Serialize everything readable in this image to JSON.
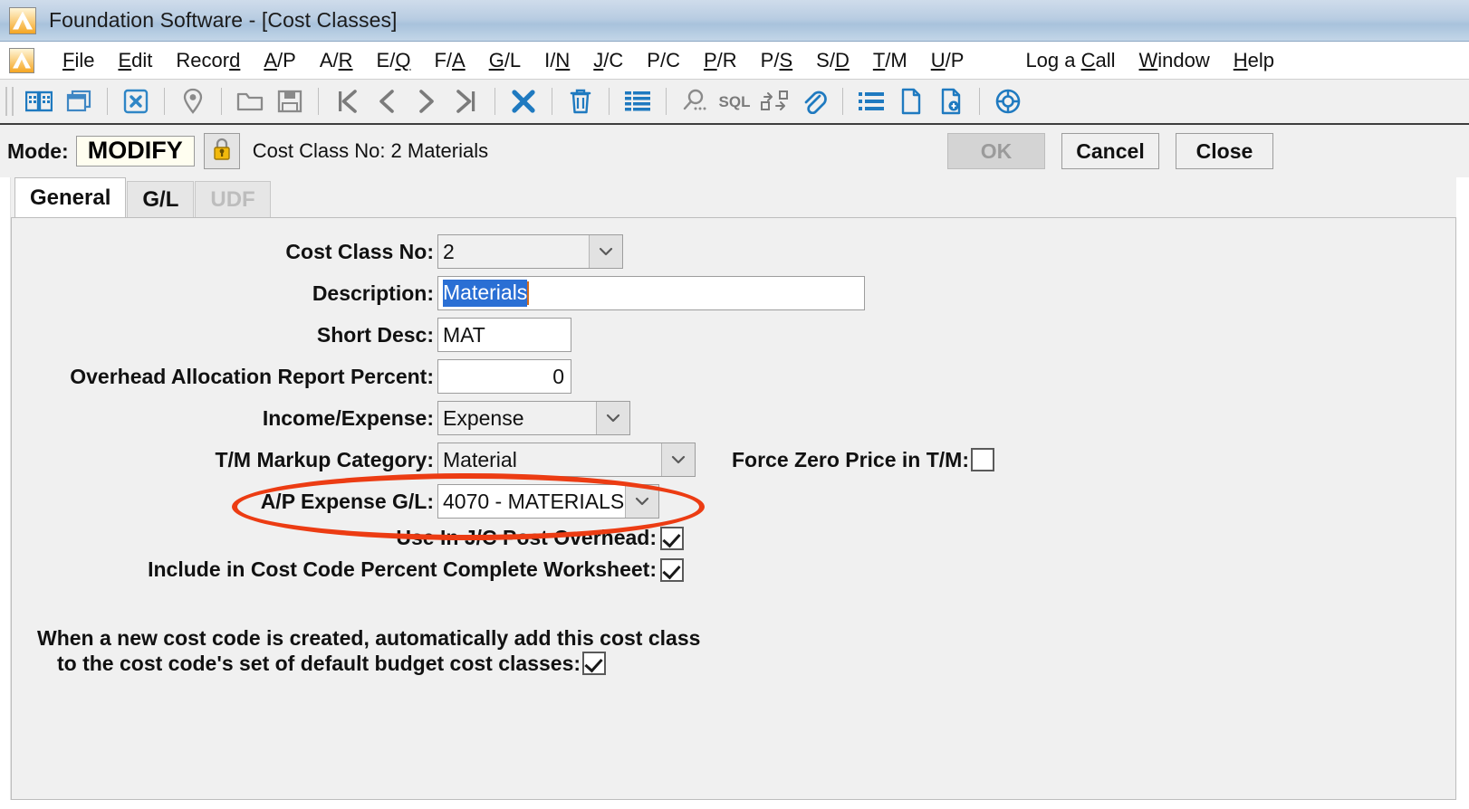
{
  "window": {
    "title": "Foundation Software - [Cost Classes]",
    "logo_icon": "mountain-logo-icon"
  },
  "menubar": {
    "items": [
      {
        "label": "File",
        "accel": "F"
      },
      {
        "label": "Edit",
        "accel": "E"
      },
      {
        "label": "Record",
        "accel": "d"
      },
      {
        "label": "A/P",
        "accel": "A"
      },
      {
        "label": "A/R",
        "accel": "R"
      },
      {
        "label": "E/Q",
        "accel": "Q"
      },
      {
        "label": "F/A",
        "accel": "A"
      },
      {
        "label": "G/L",
        "accel": "G"
      },
      {
        "label": "I/N",
        "accel": "N"
      },
      {
        "label": "J/C",
        "accel": "J"
      },
      {
        "label": "P/C",
        "accel": ""
      },
      {
        "label": "P/R",
        "accel": "P"
      },
      {
        "label": "P/S",
        "accel": "S"
      },
      {
        "label": "S/D",
        "accel": "D"
      },
      {
        "label": "T/M",
        "accel": "T"
      },
      {
        "label": "U/P",
        "accel": "U"
      },
      {
        "label": "Log a Call",
        "accel": "C"
      },
      {
        "label": "Window",
        "accel": "W"
      },
      {
        "label": "Help",
        "accel": "H"
      }
    ]
  },
  "toolbar": {
    "buttons": [
      {
        "name": "open-book-icon",
        "group": 1
      },
      {
        "name": "windows-cascade-icon",
        "group": 1
      },
      {
        "name": "close-window-x-icon",
        "group": 2
      },
      {
        "name": "location-pin-icon",
        "group": 3
      },
      {
        "name": "new-folder-icon",
        "group": 4
      },
      {
        "name": "save-disk-icon",
        "group": 4
      },
      {
        "name": "first-record-icon",
        "group": 5
      },
      {
        "name": "previous-record-icon",
        "group": 5
      },
      {
        "name": "next-record-icon",
        "group": 5
      },
      {
        "name": "last-record-icon",
        "group": 5
      },
      {
        "name": "delete-x-icon",
        "group": 6
      },
      {
        "name": "trash-can-icon",
        "group": 7
      },
      {
        "name": "grid-list-icon",
        "group": 8
      },
      {
        "name": "search-magnifier-icon",
        "group": 9
      },
      {
        "name": "sql-text-icon",
        "group": 9
      },
      {
        "name": "workflow-nodes-icon",
        "group": 9
      },
      {
        "name": "attachment-paperclip-icon",
        "group": 9
      },
      {
        "name": "bullet-list-icon",
        "group": 10
      },
      {
        "name": "document-icon",
        "group": 10
      },
      {
        "name": "document-add-icon",
        "group": 10
      },
      {
        "name": "help-lifering-icon",
        "group": 11
      }
    ]
  },
  "modebar": {
    "mode_label": "Mode:",
    "mode_value": "MODIFY",
    "lock_icon": "lock-icon",
    "record_caption": "Cost Class No: 2  Materials",
    "ok_label": "OK",
    "cancel_label": "Cancel",
    "close_label": "Close"
  },
  "tabs": [
    {
      "label": "General",
      "state": "active"
    },
    {
      "label": "G/L",
      "state": "inactive"
    },
    {
      "label": "UDF",
      "state": "disabled"
    }
  ],
  "form": {
    "cost_class_no": {
      "label": "Cost Class No:",
      "value": "2",
      "type": "combobox"
    },
    "description": {
      "label": "Description:",
      "value": "Materials",
      "selected": true,
      "type": "textbox"
    },
    "short_desc": {
      "label": "Short Desc:",
      "value": "MAT",
      "type": "textbox"
    },
    "overhead_allocation_report_percent": {
      "label": "Overhead Allocation Report Percent:",
      "value": "0",
      "type": "numeric"
    },
    "income_expense": {
      "label": "Income/Expense:",
      "value": "Expense",
      "type": "combobox"
    },
    "tm_markup_category": {
      "label": "T/M Markup Category:",
      "value": "Material",
      "type": "combobox"
    },
    "force_zero_price_in_tm": {
      "label": "Force Zero Price in T/M:",
      "checked": false,
      "type": "checkbox"
    },
    "ap_expense_gl": {
      "label": "A/P Expense G/L:",
      "value": "4070  - MATERIALS",
      "type": "combobox",
      "highlighted": true
    },
    "use_in_jc_post_overhead": {
      "label": "Use In J/C Post Overhead:",
      "checked": true,
      "type": "checkbox"
    },
    "include_in_cost_code_percent_complete_worksheet": {
      "label": "Include in Cost Code Percent Complete Worksheet:",
      "checked": true,
      "type": "checkbox"
    },
    "default_budget_note": {
      "line1": "When a new cost code is created, automatically add this cost class",
      "line2": "to the cost code's set of default budget cost classes:",
      "checked": true
    }
  },
  "annotation": {
    "color": "#ec3c13",
    "shape": "ellipse",
    "target": "ap-expense-gl-row"
  },
  "colors": {
    "accent_blue": "#1f7ac0",
    "selection_blue": "#2a6fd4",
    "annotation_red": "#ec3c13",
    "panel_gray": "#f0f0f0",
    "titlebar_blue": "#b9cde2"
  }
}
